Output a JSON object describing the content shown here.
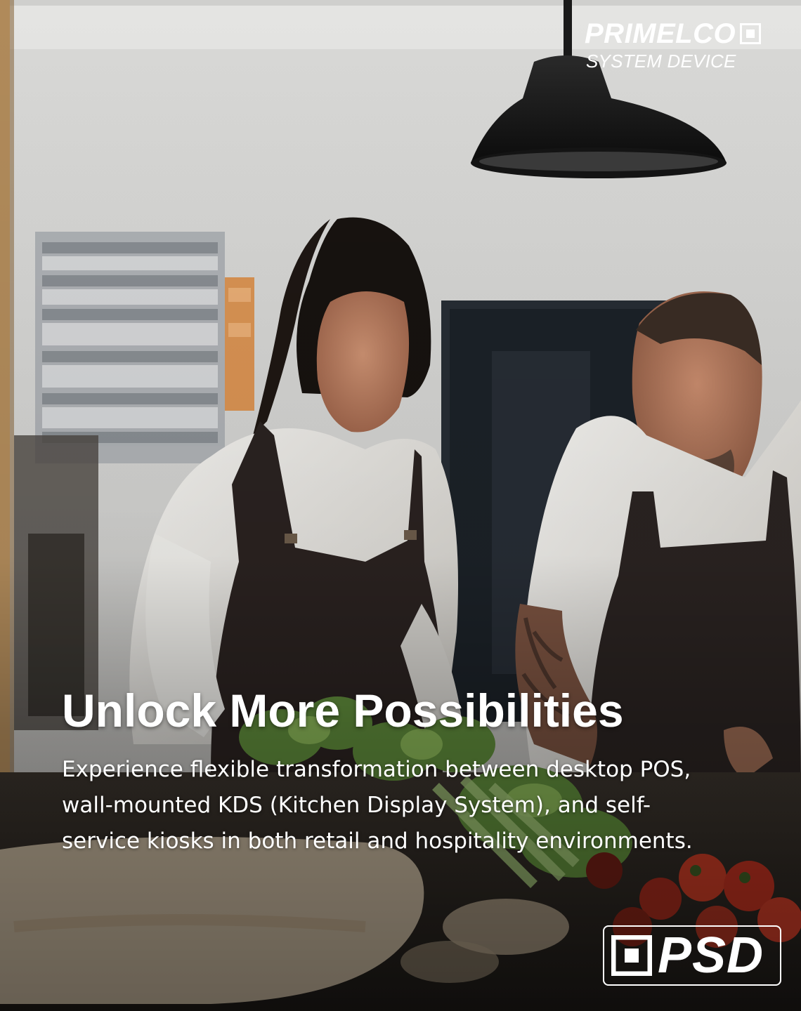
{
  "brand": {
    "name": "PRIMELCO",
    "tagline": "SYSTEM DEVICE",
    "badge": "PSD",
    "color": "#ffffff"
  },
  "hero": {
    "headline": "Unlock More Possibilities",
    "body": "Experience flexible transformation between desktop POS, wall-mounted KDS (Kitchen Display System), and self-service kiosks in both retail and hospitality environments."
  },
  "icons": [
    "primelco-square-icon",
    "psd-square-icon"
  ]
}
